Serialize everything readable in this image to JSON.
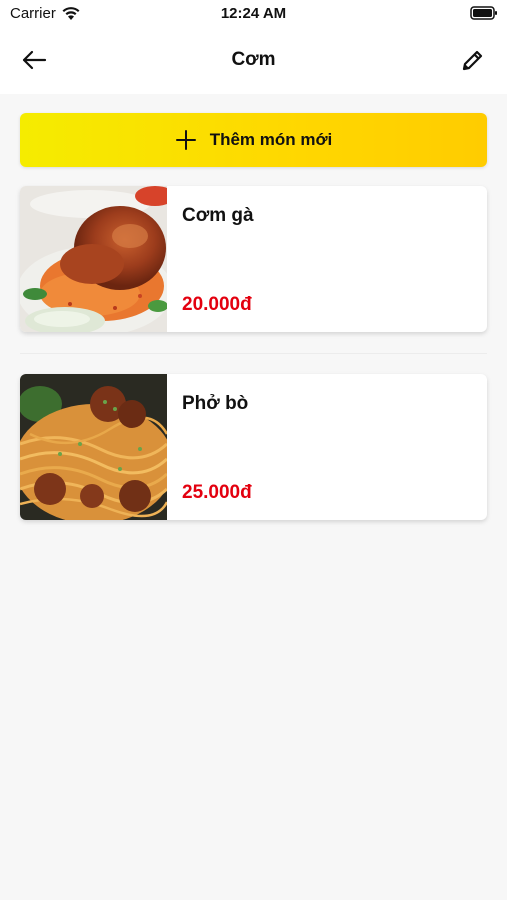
{
  "status_bar": {
    "carrier": "Carrier",
    "time": "12:24 AM",
    "icons": [
      "wifi-icon",
      "battery-icon"
    ]
  },
  "nav": {
    "title": "Cơm",
    "back_icon": "back-arrow-icon",
    "edit_icon": "pencil-icon"
  },
  "add_button": {
    "label": "Thêm món mới",
    "icon": "plus-icon"
  },
  "menu_items": [
    {
      "name": "Cơm gà",
      "price": "20.000đ",
      "image": "roast-chicken-rice-photo"
    },
    {
      "name": "Phở bò",
      "price": "25.000đ",
      "image": "spaghetti-meatballs-photo"
    }
  ],
  "colors": {
    "accent_start": "#f5ec00",
    "accent_end": "#ffcc00",
    "price": "#e3000f",
    "background": "#f7f7f7"
  }
}
